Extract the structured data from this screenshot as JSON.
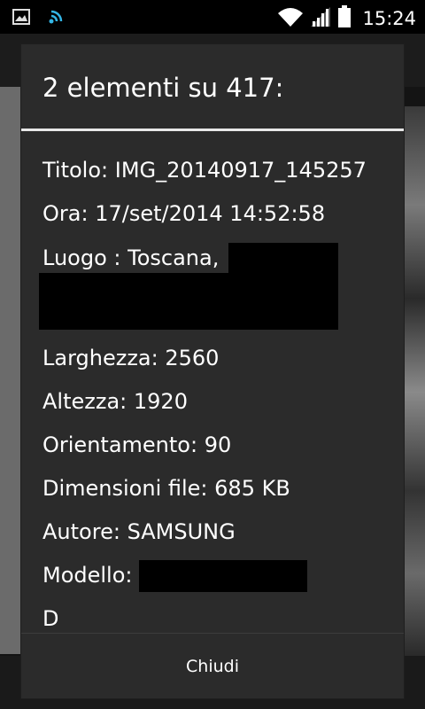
{
  "status_bar": {
    "time": "15:24",
    "icons": [
      "image-icon",
      "wifi-icon",
      "signal-icon",
      "battery-icon"
    ]
  },
  "dialog": {
    "title": "2 elementi su 417:",
    "details": [
      {
        "label": "Titolo:",
        "value": "IMG_20140917_145257"
      },
      {
        "label": "Ora:",
        "value": "17/set/2014 14:52:58"
      },
      {
        "label": "Luogo :",
        "value": "Toscana,"
      },
      {
        "label": "Larghezza:",
        "value": "2560"
      },
      {
        "label": "Altezza:",
        "value": "1920"
      },
      {
        "label": "Orientamento:",
        "value": "90"
      },
      {
        "label": "Dimensioni file:",
        "value": "685 KB"
      },
      {
        "label": "Autore:",
        "value": "SAMSUNG"
      },
      {
        "label": "Modello:",
        "value": ""
      },
      {
        "label": "D",
        "value": ""
      }
    ],
    "close_label": "Chiudi"
  },
  "colors": {
    "dialog_bg": "#2b2b2b",
    "divider": "#e8e8e8",
    "text": "#ffffff"
  }
}
